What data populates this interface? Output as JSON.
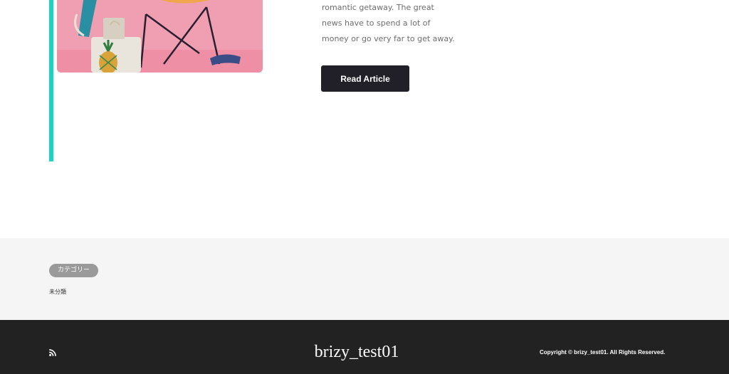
{
  "article": {
    "excerpt_lines": [
      "romantic getaway. The great",
      "news have to spend a lot of",
      "money or go very far to get away."
    ],
    "read_button_label": "Read Article"
  },
  "colors": {
    "accent": "#19d3c5",
    "button_bg": "#211f28",
    "footer_bg": "#222222",
    "widget_bg": "#f5f5f5"
  },
  "widget": {
    "title": "カテゴリー",
    "categories": [
      "未分類"
    ]
  },
  "footer": {
    "icon": "rss-icon",
    "site_title": "brizy_test01",
    "copyright": "Copyright © brizy_test01. All Rights Reserved."
  }
}
